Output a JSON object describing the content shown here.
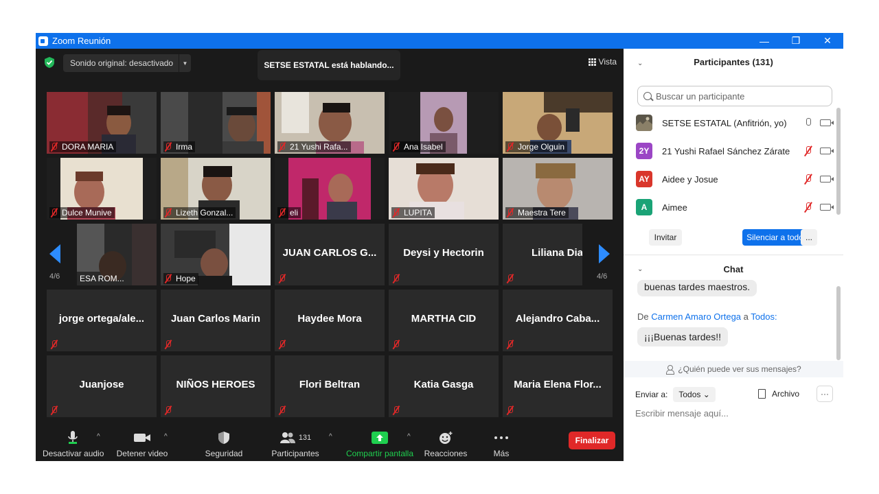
{
  "window": {
    "title": "Zoom Reunión",
    "controls": [
      "—",
      "❐",
      "✕"
    ]
  },
  "topbar": {
    "sound_label": "Sonido original: desactivado",
    "speaking_banner": "SETSE ESTATAL está hablando...",
    "view_label": "Vista"
  },
  "grid": {
    "page_indicator": "4/6",
    "video_tiles": [
      {
        "name": "DORA MARIA"
      },
      {
        "name": "Irma"
      },
      {
        "name": "21 Yushi Rafa..."
      },
      {
        "name": "Ana Isabel"
      },
      {
        "name": "Jorge Olguin"
      },
      {
        "name": "Dulce Munive"
      },
      {
        "name": "Lizeth Gonzal..."
      },
      {
        "name": "eli"
      },
      {
        "name": "LUPITA"
      },
      {
        "name": "Maestra Tere"
      },
      {
        "name": "ESA ROM..."
      },
      {
        "name": "Hope"
      }
    ],
    "name_tiles": [
      "JUAN CARLOS G...",
      "Deysi y Hectorin",
      "Liliana Diaz",
      "jorge  ortega/ale...",
      "Juan Carlos Marin",
      "Haydee Mora",
      "MARTHA CID",
      "Alejandro  Caba...",
      "Juanjose",
      "NIÑOS HEROES",
      "Flori Beltran",
      "Katia Gasga",
      "Maria  Elena  Flor..."
    ]
  },
  "toolbar": {
    "audio": "Desactivar audio",
    "video": "Detener video",
    "security": "Seguridad",
    "participants": "Participantes",
    "participant_count": "131",
    "share": "Compartir pantalla",
    "reactions": "Reacciones",
    "more": "Más",
    "end": "Finalizar"
  },
  "participants_panel": {
    "title": "Participantes (131)",
    "search_placeholder": "Buscar un participante",
    "rows": [
      {
        "initials": "",
        "name": "SETSE ESTATAL (Anfitrión, yo)",
        "avatar_color": "#5a5548",
        "muted": false
      },
      {
        "initials": "2Y",
        "name": "21 Yushi Rafael Sánchez Zárate",
        "avatar_color": "#9b46c5",
        "muted": true
      },
      {
        "initials": "AY",
        "name": "Aidee y Josue",
        "avatar_color": "#d9362b",
        "muted": true
      },
      {
        "initials": "A",
        "name": "Aimee",
        "avatar_color": "#1aa376",
        "muted": true
      }
    ],
    "invite": "Invitar",
    "mute_all": "Silenciar a todos",
    "more": "..."
  },
  "chat": {
    "title": "Chat",
    "prev_message": "buenas tardes maestros.",
    "from_prefix": "De",
    "sender": "Carmen Amaro Ortega",
    "to_word": "a",
    "recipient": "Todos:",
    "message": "¡¡¡Buenas tardes!!",
    "who_can_see": "¿Quién puede ver sus mensajes?",
    "send_to_label": "Enviar a:",
    "send_to_value": "Todos",
    "file_label": "Archivo",
    "more": "···",
    "input_placeholder": "Escribir mensaje aquí..."
  }
}
